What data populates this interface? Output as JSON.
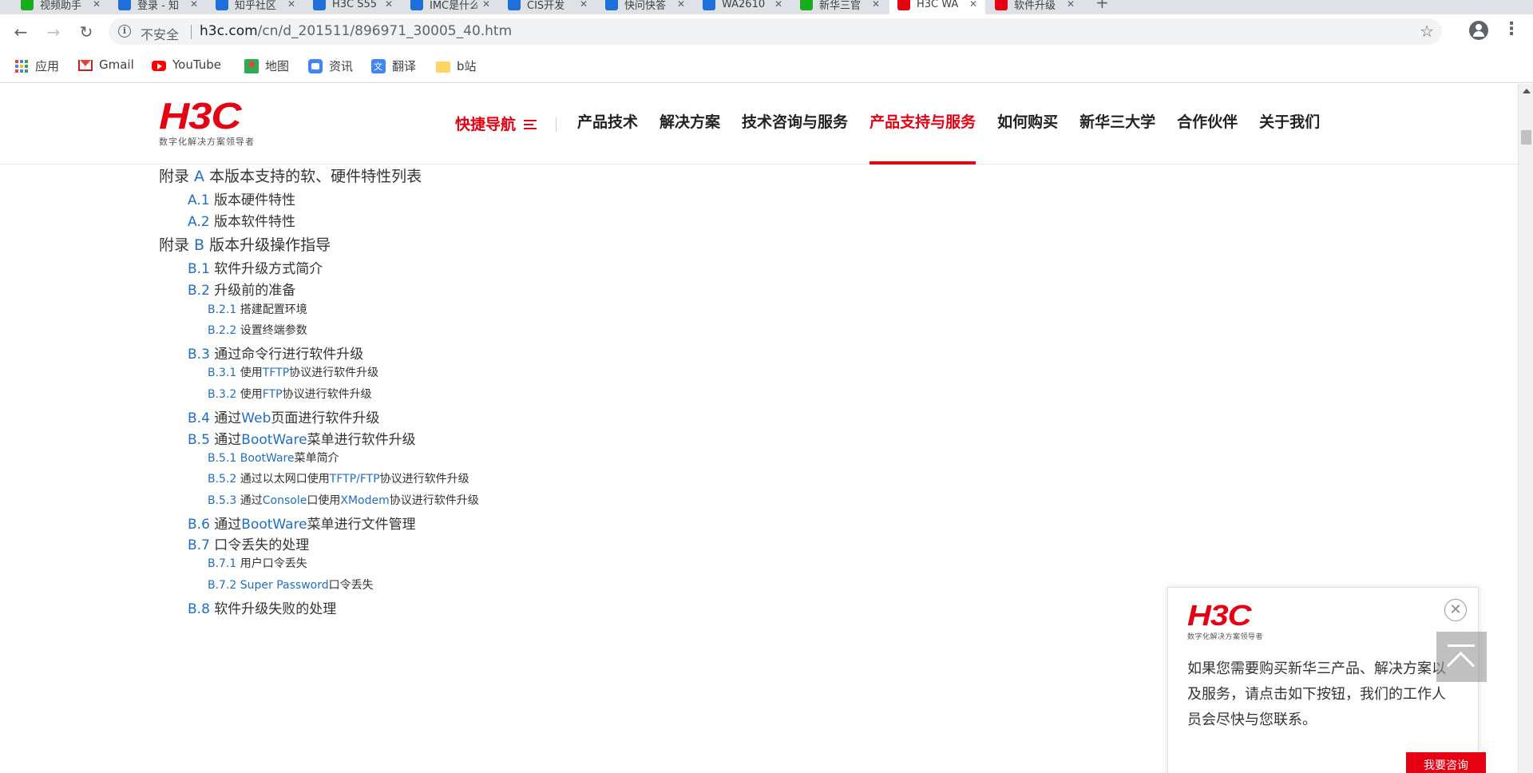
{
  "browser": {
    "tabs": [
      {
        "title": "视频助手",
        "color": "#1aad19"
      },
      {
        "title": "登录 - 知",
        "color": "#1e6fd9"
      },
      {
        "title": "知乎社区",
        "color": "#1e6fd9"
      },
      {
        "title": "H3C S55",
        "color": "#1e6fd9"
      },
      {
        "title": "IMC是什么",
        "color": "#1e6fd9"
      },
      {
        "title": "CIS开发",
        "color": "#1e6fd9"
      },
      {
        "title": "快问快答",
        "color": "#1e6fd9"
      },
      {
        "title": "WA2610",
        "color": "#1e6fd9"
      },
      {
        "title": "新华三官",
        "color": "#1aad19"
      },
      {
        "title": "H3C WA",
        "color": "#e60012",
        "active": true
      },
      {
        "title": "软件升级",
        "color": "#e60012"
      }
    ],
    "tab_close": "✕",
    "new_tab": "+",
    "back": "←",
    "forward": "→",
    "reload": "↻",
    "info_icon": "i",
    "insecure_label": "不安全",
    "url_host": "h3c.com",
    "url_path": "/cn/d_201511/896971_30005_40.htm",
    "star": "☆",
    "menu": "⋮",
    "bookmarks": [
      {
        "label": "应用",
        "icon": "apps-icon"
      },
      {
        "label": "Gmail",
        "icon": "gmail-icon"
      },
      {
        "label": "YouTube",
        "icon": "youtube-icon"
      },
      {
        "label": "地图",
        "icon": "maps-icon"
      },
      {
        "label": "资讯",
        "icon": "news-icon"
      },
      {
        "label": "翻译",
        "icon": "translate-icon"
      },
      {
        "label": "b站",
        "icon": "folder-icon"
      }
    ]
  },
  "site": {
    "logo": "H3C",
    "logo_tagline": "数字化解决方案领导者",
    "nav": {
      "quick": "快捷导航",
      "items": [
        "产品技术",
        "解决方案",
        "技术咨询与服务",
        "产品支持与服务",
        "如何购买",
        "新华三大学",
        "合作伙伴",
        "关于我们"
      ],
      "active_index": 3
    },
    "accent": "#e60012",
    "link": "#1f6fc5"
  },
  "toc": [
    {
      "level": 1,
      "num": "",
      "pre": "附录 ",
      "blue": "A",
      "post": " 本版本支持的软、硬件特性列表",
      "y": 0
    },
    {
      "level": 2,
      "num": "A.1",
      "pre": "",
      "blue": "",
      "post": " 版本硬件特性",
      "y": 1
    },
    {
      "level": 2,
      "num": "A.2",
      "pre": "",
      "blue": "",
      "post": " 版本软件特性",
      "y": 2
    },
    {
      "level": 1,
      "num": "",
      "pre": "附录 ",
      "blue": "B",
      "post": " 版本升级操作指导",
      "y": 3
    },
    {
      "level": 2,
      "num": "B.1",
      "pre": "",
      "blue": "",
      "post": " 软件升级方式简介",
      "y": 4
    },
    {
      "level": 2,
      "num": "B.2",
      "pre": "",
      "blue": "",
      "post": " 升级前的准备",
      "y": 5
    },
    {
      "level": 3,
      "num": "B.2.1",
      "pre": "",
      "blue": "",
      "post": " 搭建配置环境",
      "y": 6
    },
    {
      "level": 3,
      "num": "B.2.2",
      "pre": "",
      "blue": "",
      "post": " 设置终端参数",
      "y": 7
    },
    {
      "level": 2,
      "num": "B.3",
      "pre": "",
      "blue": "",
      "post": " 通过命令行进行软件升级",
      "y": 8
    },
    {
      "level": 3,
      "num": "B.3.1",
      "pre": " 使用",
      "blue": "TFTP",
      "post": "协议进行软件升级",
      "y": 9
    },
    {
      "level": 3,
      "num": "B.3.2",
      "pre": " 使用",
      "blue": "FTP",
      "post": "协议进行软件升级",
      "y": 10
    },
    {
      "level": 2,
      "num": "B.4",
      "pre": " 通过",
      "blue": "Web",
      "post": "页面进行软件升级",
      "y": 11
    },
    {
      "level": 2,
      "num": "B.5",
      "pre": " 通过",
      "blue": "BootWare",
      "post": "菜单进行软件升级",
      "y": 12
    },
    {
      "level": 3,
      "num": "B.5.1",
      "pre": " ",
      "blue": "BootWare",
      "post": "菜单简介",
      "y": 13
    },
    {
      "level": 3,
      "num": "B.5.2",
      "pre": " 通过以太网口使用",
      "blue": "TFTP/FTP",
      "post": "协议进行软件升级",
      "y": 14
    },
    {
      "level": 3,
      "num": "B.5.3",
      "pre": " 通过",
      "blue": "Console",
      "post": "口使用",
      "blue2": "XModem",
      "post2": "协议进行软件升级",
      "y": 15
    },
    {
      "level": 2,
      "num": "B.6",
      "pre": " 通过",
      "blue": "BootWare",
      "post": "菜单进行文件管理",
      "y": 16
    },
    {
      "level": 2,
      "num": "B.7",
      "pre": "",
      "blue": "",
      "post": " 口令丢失的处理",
      "y": 17
    },
    {
      "level": 3,
      "num": "B.7.1",
      "pre": "",
      "blue": "",
      "post": " 用户口令丢失",
      "y": 18
    },
    {
      "level": 3,
      "num": "B.7.2",
      "pre": " ",
      "blue": "Super Password",
      "post": "口令丢失",
      "y": 19
    },
    {
      "level": 2,
      "num": "B.8",
      "pre": "",
      "blue": "",
      "post": " 软件升级失败的处理",
      "y": 20
    }
  ],
  "consult": {
    "logo": "H3C",
    "logo_tagline": "数字化解决方案领导者",
    "text": "如果您需要购买新华三产品、解决方案以及服务，请点击如下按钮，我们的工作人员会尽快与您联系。",
    "button": "我要咨询",
    "close": "✕"
  }
}
